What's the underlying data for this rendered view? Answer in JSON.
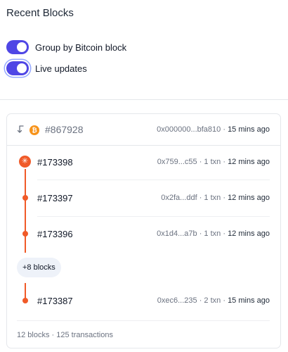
{
  "page": {
    "title": "Recent Blocks"
  },
  "toggles": [
    {
      "label": "Group by Bitcoin block",
      "checked": true
    },
    {
      "label": "Live updates",
      "checked": true
    }
  ],
  "colors": {
    "accent": "#4f46e5",
    "timeline": "#f05a28",
    "bitcoin": "#f7931a"
  },
  "bitcoin_block": {
    "number": "#867928",
    "hash": "0x000000...bfa810",
    "separator": " · ",
    "time": "15 mins ago",
    "icon": "bitcoin-icon"
  },
  "blocks": [
    {
      "number": "#173398",
      "hash": "0x759...c55",
      "txns": "1 txn",
      "time": "12 mins ago"
    },
    {
      "number": "#173397",
      "hash": "0x2fa...ddf",
      "txns": "1 txn",
      "time": "12 mins ago"
    },
    {
      "number": "#173396",
      "hash": "0x1d4...a7b",
      "txns": "1 txn",
      "time": "12 mins ago"
    },
    {
      "number": "#173387",
      "hash": "0xec6...235",
      "txns": "2 txn",
      "time": "15 mins ago"
    }
  ],
  "more_blocks": {
    "label": "+8 blocks"
  },
  "footer": {
    "summary": "12 blocks · 125 transactions"
  }
}
